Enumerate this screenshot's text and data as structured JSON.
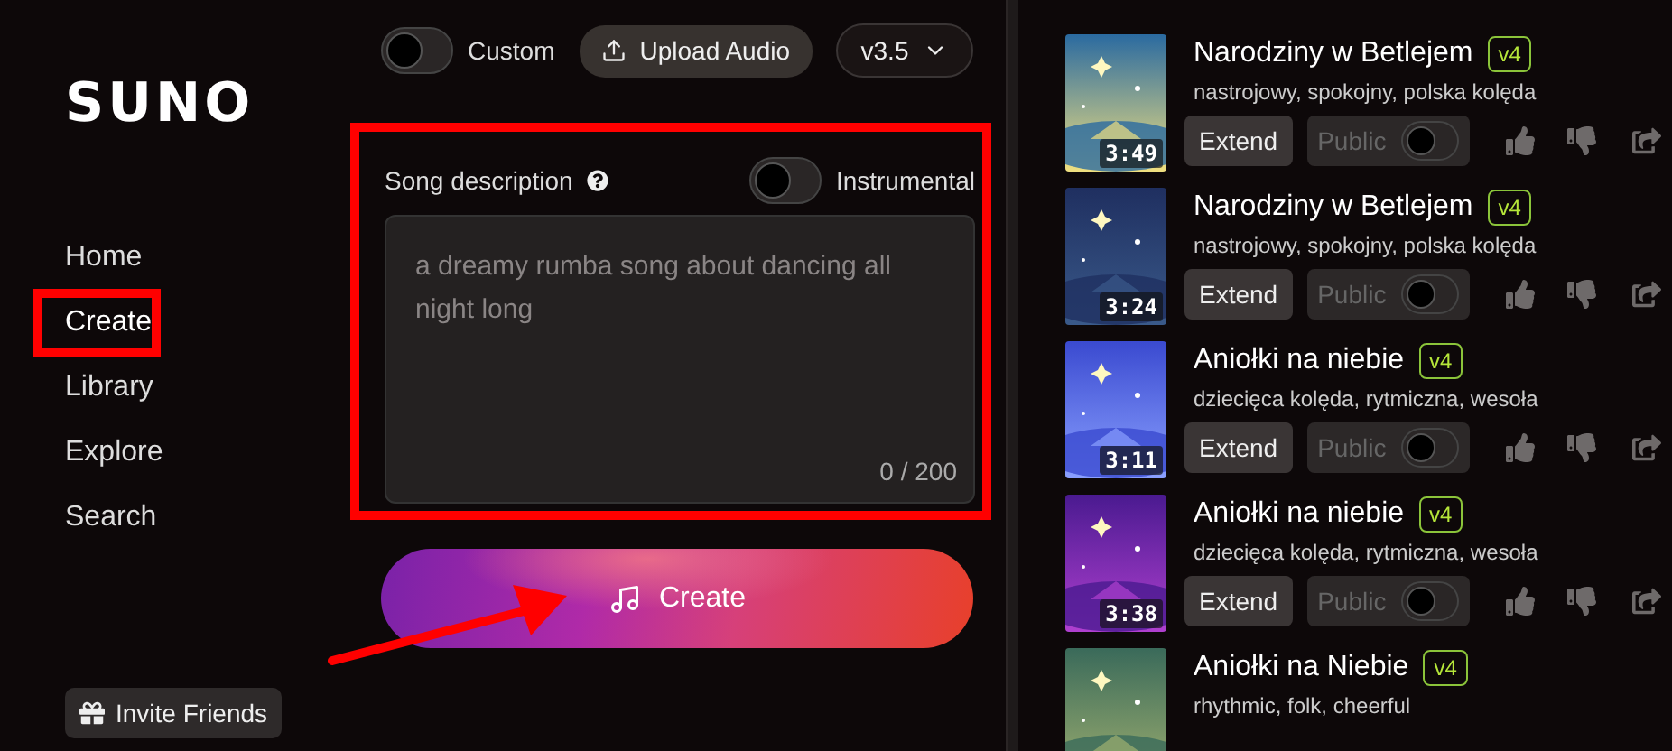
{
  "logo": "SUNO",
  "nav": [
    {
      "label": "Home",
      "selected": false,
      "highlighted": false
    },
    {
      "label": "Create",
      "selected": true,
      "highlighted": true
    },
    {
      "label": "Library",
      "selected": false,
      "highlighted": false
    },
    {
      "label": "Explore",
      "selected": false,
      "highlighted": false
    },
    {
      "label": "Search",
      "selected": false,
      "highlighted": false
    }
  ],
  "invite_button": "Invite Friends",
  "toolbar": {
    "custom_toggle": {
      "label": "Custom",
      "on": false
    },
    "upload_button": "Upload Audio",
    "version_select": "v3.5"
  },
  "description_card": {
    "label": "Song description",
    "highlighted": true,
    "instrumental": {
      "label": "Instrumental",
      "on": false
    },
    "placeholder": "a dreamy rumba song about dancing all night long",
    "counter": "0 / 200"
  },
  "create_button": "Create",
  "songs": [
    {
      "title": "Narodziny w Betlejem",
      "version": "v4",
      "tags": "nastrojowy, spokojny, polska kolęda",
      "duration": "3:49",
      "extend": "Extend",
      "public": {
        "label": "Public",
        "on": false
      }
    },
    {
      "title": "Narodziny w Betlejem",
      "version": "v4",
      "tags": "nastrojowy, spokojny, polska kolęda",
      "duration": "3:24",
      "extend": "Extend",
      "public": {
        "label": "Public",
        "on": false
      }
    },
    {
      "title": "Aniołki na niebie",
      "version": "v4",
      "tags": "dziecięca kolęda, rytmiczna, wesoła",
      "duration": "3:11",
      "extend": "Extend",
      "public": {
        "label": "Public",
        "on": false
      }
    },
    {
      "title": "Aniołki na niebie",
      "version": "v4",
      "tags": "dziecięca kolęda, rytmiczna, wesoła",
      "duration": "3:38",
      "extend": "Extend",
      "public": {
        "label": "Public",
        "on": false
      }
    },
    {
      "title": "Aniołki na Niebie",
      "version": "v4",
      "tags": "rhythmic, folk, cheerful"
    }
  ]
}
